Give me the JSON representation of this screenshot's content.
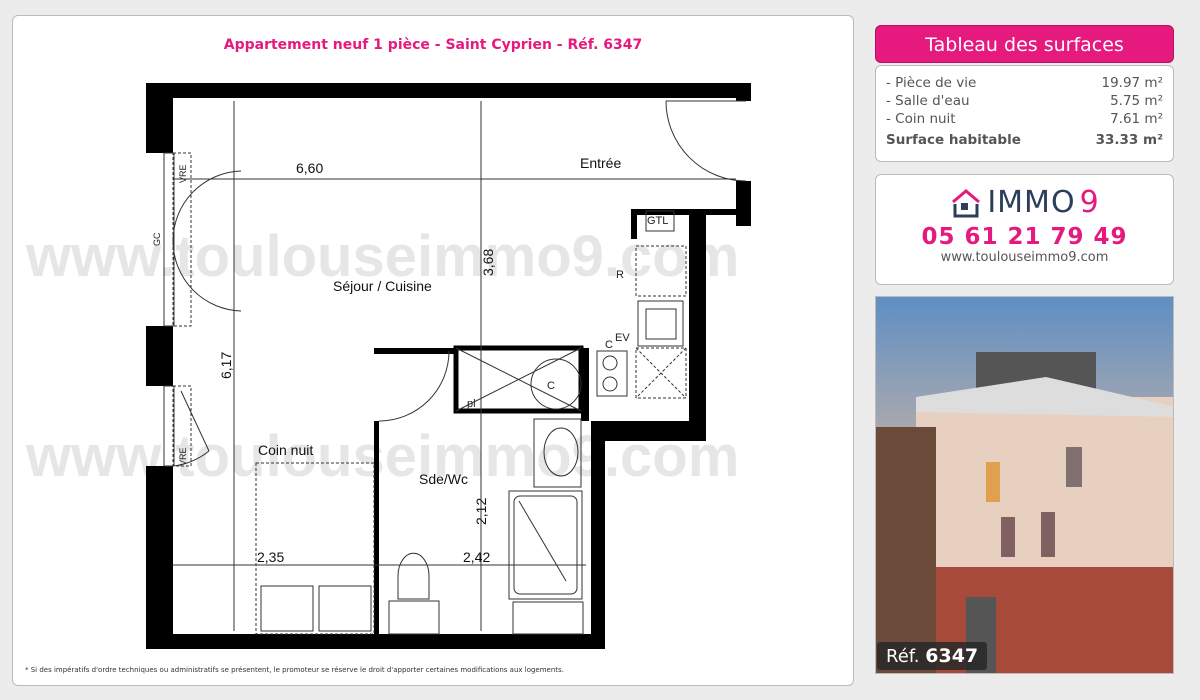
{
  "listing": {
    "title": "Appartement neuf 1 pièce - Saint Cyprien - Réf. 6347",
    "disclaimer": "* Si des impératifs d'ordre techniques ou administratifs se présentent, le promoteur se réserve le droit d'apporter certaines modifications aux logements."
  },
  "plan": {
    "watermark": "www.toulouseimmo9.com",
    "rooms": {
      "entree": "Entrée",
      "sejour": "Séjour / Cuisine",
      "coin_nuit": "Coin nuit",
      "sde": "Sde/Wc"
    },
    "dimensions": {
      "d660": "6,60",
      "d368": "3,68",
      "d617": "6,17",
      "d212": "2,12",
      "d235": "2,35",
      "d242": "2,42"
    },
    "symbols": {
      "gtl": "GTL",
      "r": "R",
      "ev": "EV",
      "c1": "C",
      "c2": "C",
      "pl": "pl",
      "gc": "GC",
      "vre1": "VRE",
      "vre2": "VRE"
    }
  },
  "surfaces": {
    "header": "Tableau des surfaces",
    "items": [
      {
        "label": "- Pièce de vie",
        "value": "19.97 m²"
      },
      {
        "label": "- Salle d'eau",
        "value": "5.75 m²"
      },
      {
        "label": "- Coin nuit",
        "value": "7.61 m²"
      }
    ],
    "total": {
      "label": "Surface habitable",
      "value": "33.33 m²"
    }
  },
  "agency": {
    "logo_text": "IMMO",
    "logo_nine": "9",
    "phone": "05 61 21 79 49",
    "website": "www.toulouseimmo9.com",
    "brand_color": "#e5197e",
    "logo_color": "#2c3e5a"
  },
  "ref_badge": {
    "prefix": "Réf.",
    "number": "6347"
  }
}
